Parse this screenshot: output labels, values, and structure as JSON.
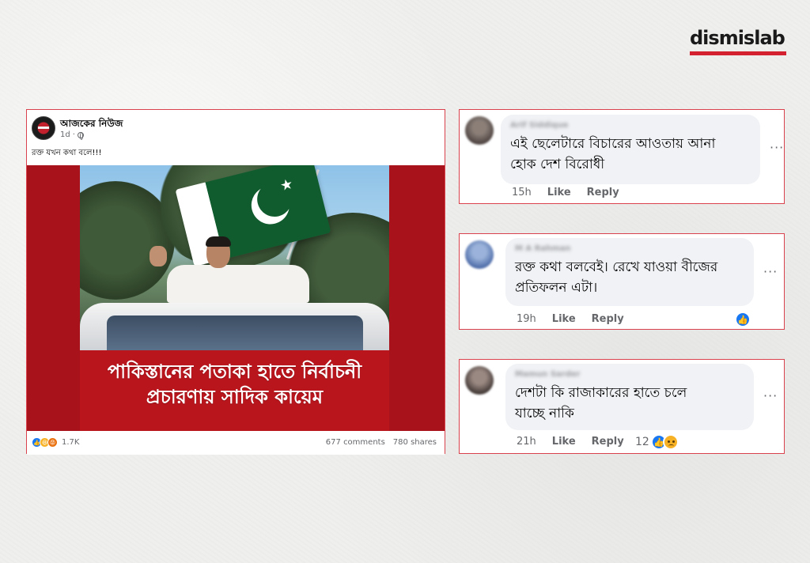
{
  "brand": {
    "name": "dismislab",
    "accent_color": "#d42130"
  },
  "post": {
    "page_name": "আজকের নিউজ",
    "time": "1d",
    "caption": "রক্ত যখন কথা বলে!!!",
    "headline_line1": "পাকিস্তানের পতাকা হাতে নির্বাচনী",
    "headline_line2": "প্রচারণায় সাদিক কায়েম",
    "reaction_icons": [
      "like-icon",
      "haha-icon",
      "angry-icon"
    ],
    "reaction_count": "1.7K",
    "comments_count": "677 comments",
    "shares_count": "780 shares"
  },
  "comments": [
    {
      "author": "Arif Siddique",
      "text_line1": "এই ছেলেটারে বিচারের আওতায় আনা",
      "text_line2": "হোক দেশ বিরোধী",
      "time": "15h",
      "like_label": "Like",
      "reply_label": "Reply"
    },
    {
      "author": "M A Rahman",
      "text_line1": "রক্ত কথা বলবেই। রেখে যাওয়া বীজের",
      "text_line2": "প্রতিফলন এটা।",
      "time": "19h",
      "like_label": "Like",
      "reply_label": "Reply"
    },
    {
      "author": "Mamun Sarder",
      "text_line1": "দেশটা কি রাজাকারের হাতে চলে",
      "text_line2": "যাচ্ছে নাকি",
      "time": "21h",
      "like_label": "Like",
      "reply_label": "Reply",
      "reaction_count": "12"
    }
  ]
}
